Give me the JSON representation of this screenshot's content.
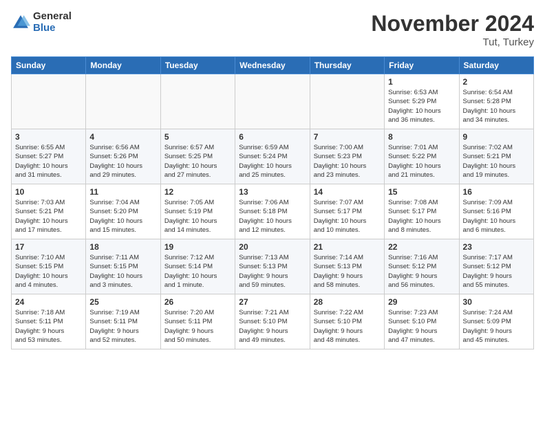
{
  "header": {
    "logo_general": "General",
    "logo_blue": "Blue",
    "month_title": "November 2024",
    "location": "Tut, Turkey"
  },
  "weekdays": [
    "Sunday",
    "Monday",
    "Tuesday",
    "Wednesday",
    "Thursday",
    "Friday",
    "Saturday"
  ],
  "weeks": [
    [
      {
        "day": "",
        "info": ""
      },
      {
        "day": "",
        "info": ""
      },
      {
        "day": "",
        "info": ""
      },
      {
        "day": "",
        "info": ""
      },
      {
        "day": "",
        "info": ""
      },
      {
        "day": "1",
        "info": "Sunrise: 6:53 AM\nSunset: 5:29 PM\nDaylight: 10 hours\nand 36 minutes."
      },
      {
        "day": "2",
        "info": "Sunrise: 6:54 AM\nSunset: 5:28 PM\nDaylight: 10 hours\nand 34 minutes."
      }
    ],
    [
      {
        "day": "3",
        "info": "Sunrise: 6:55 AM\nSunset: 5:27 PM\nDaylight: 10 hours\nand 31 minutes."
      },
      {
        "day": "4",
        "info": "Sunrise: 6:56 AM\nSunset: 5:26 PM\nDaylight: 10 hours\nand 29 minutes."
      },
      {
        "day": "5",
        "info": "Sunrise: 6:57 AM\nSunset: 5:25 PM\nDaylight: 10 hours\nand 27 minutes."
      },
      {
        "day": "6",
        "info": "Sunrise: 6:59 AM\nSunset: 5:24 PM\nDaylight: 10 hours\nand 25 minutes."
      },
      {
        "day": "7",
        "info": "Sunrise: 7:00 AM\nSunset: 5:23 PM\nDaylight: 10 hours\nand 23 minutes."
      },
      {
        "day": "8",
        "info": "Sunrise: 7:01 AM\nSunset: 5:22 PM\nDaylight: 10 hours\nand 21 minutes."
      },
      {
        "day": "9",
        "info": "Sunrise: 7:02 AM\nSunset: 5:21 PM\nDaylight: 10 hours\nand 19 minutes."
      }
    ],
    [
      {
        "day": "10",
        "info": "Sunrise: 7:03 AM\nSunset: 5:21 PM\nDaylight: 10 hours\nand 17 minutes."
      },
      {
        "day": "11",
        "info": "Sunrise: 7:04 AM\nSunset: 5:20 PM\nDaylight: 10 hours\nand 15 minutes."
      },
      {
        "day": "12",
        "info": "Sunrise: 7:05 AM\nSunset: 5:19 PM\nDaylight: 10 hours\nand 14 minutes."
      },
      {
        "day": "13",
        "info": "Sunrise: 7:06 AM\nSunset: 5:18 PM\nDaylight: 10 hours\nand 12 minutes."
      },
      {
        "day": "14",
        "info": "Sunrise: 7:07 AM\nSunset: 5:17 PM\nDaylight: 10 hours\nand 10 minutes."
      },
      {
        "day": "15",
        "info": "Sunrise: 7:08 AM\nSunset: 5:17 PM\nDaylight: 10 hours\nand 8 minutes."
      },
      {
        "day": "16",
        "info": "Sunrise: 7:09 AM\nSunset: 5:16 PM\nDaylight: 10 hours\nand 6 minutes."
      }
    ],
    [
      {
        "day": "17",
        "info": "Sunrise: 7:10 AM\nSunset: 5:15 PM\nDaylight: 10 hours\nand 4 minutes."
      },
      {
        "day": "18",
        "info": "Sunrise: 7:11 AM\nSunset: 5:15 PM\nDaylight: 10 hours\nand 3 minutes."
      },
      {
        "day": "19",
        "info": "Sunrise: 7:12 AM\nSunset: 5:14 PM\nDaylight: 10 hours\nand 1 minute."
      },
      {
        "day": "20",
        "info": "Sunrise: 7:13 AM\nSunset: 5:13 PM\nDaylight: 9 hours\nand 59 minutes."
      },
      {
        "day": "21",
        "info": "Sunrise: 7:14 AM\nSunset: 5:13 PM\nDaylight: 9 hours\nand 58 minutes."
      },
      {
        "day": "22",
        "info": "Sunrise: 7:16 AM\nSunset: 5:12 PM\nDaylight: 9 hours\nand 56 minutes."
      },
      {
        "day": "23",
        "info": "Sunrise: 7:17 AM\nSunset: 5:12 PM\nDaylight: 9 hours\nand 55 minutes."
      }
    ],
    [
      {
        "day": "24",
        "info": "Sunrise: 7:18 AM\nSunset: 5:11 PM\nDaylight: 9 hours\nand 53 minutes."
      },
      {
        "day": "25",
        "info": "Sunrise: 7:19 AM\nSunset: 5:11 PM\nDaylight: 9 hours\nand 52 minutes."
      },
      {
        "day": "26",
        "info": "Sunrise: 7:20 AM\nSunset: 5:11 PM\nDaylight: 9 hours\nand 50 minutes."
      },
      {
        "day": "27",
        "info": "Sunrise: 7:21 AM\nSunset: 5:10 PM\nDaylight: 9 hours\nand 49 minutes."
      },
      {
        "day": "28",
        "info": "Sunrise: 7:22 AM\nSunset: 5:10 PM\nDaylight: 9 hours\nand 48 minutes."
      },
      {
        "day": "29",
        "info": "Sunrise: 7:23 AM\nSunset: 5:10 PM\nDaylight: 9 hours\nand 47 minutes."
      },
      {
        "day": "30",
        "info": "Sunrise: 7:24 AM\nSunset: 5:09 PM\nDaylight: 9 hours\nand 45 minutes."
      }
    ]
  ]
}
